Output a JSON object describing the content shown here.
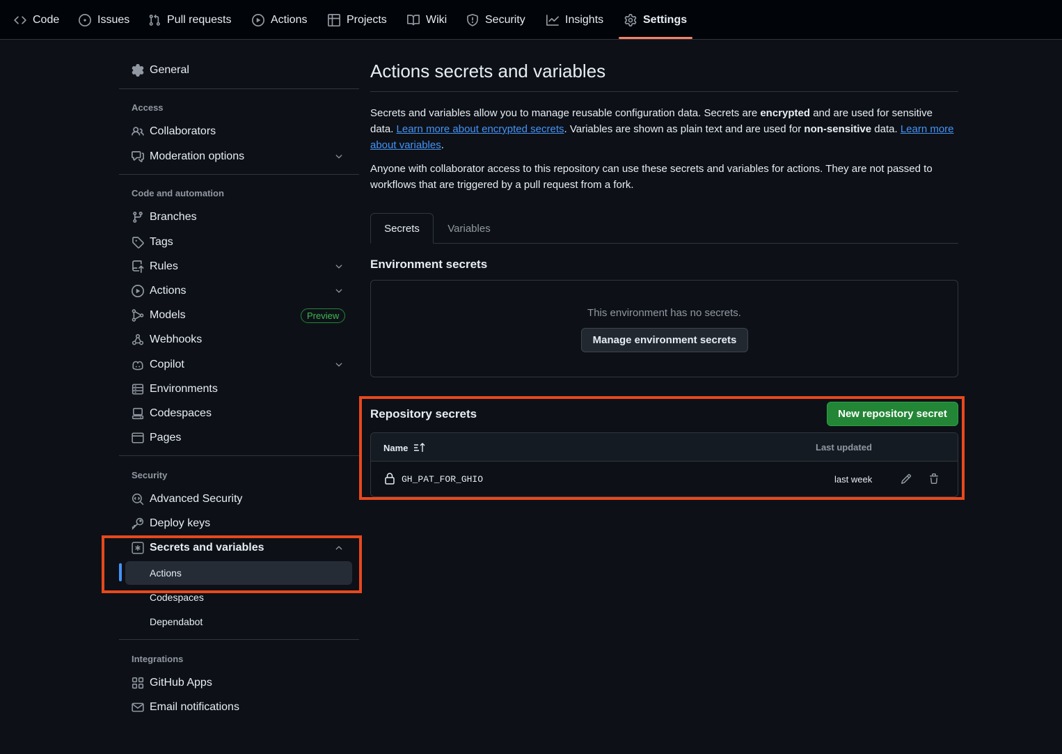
{
  "repo_nav": {
    "tabs": [
      {
        "label": "Code",
        "icon": "code-icon"
      },
      {
        "label": "Issues",
        "icon": "issue-opened-icon"
      },
      {
        "label": "Pull requests",
        "icon": "git-pull-request-icon"
      },
      {
        "label": "Actions",
        "icon": "play-icon"
      },
      {
        "label": "Projects",
        "icon": "table-icon"
      },
      {
        "label": "Wiki",
        "icon": "book-icon"
      },
      {
        "label": "Security",
        "icon": "shield-icon"
      },
      {
        "label": "Insights",
        "icon": "graph-icon"
      },
      {
        "label": "Settings",
        "icon": "gear-icon"
      }
    ],
    "selected": "Settings"
  },
  "sidebar": {
    "general": "General",
    "access": {
      "heading": "Access",
      "items": [
        "Collaborators",
        "Moderation options"
      ]
    },
    "code_automation": {
      "heading": "Code and automation",
      "items": [
        "Branches",
        "Tags",
        "Rules",
        "Actions",
        "Models",
        "Webhooks",
        "Copilot",
        "Environments",
        "Codespaces",
        "Pages"
      ],
      "models_badge": "Preview"
    },
    "security": {
      "heading": "Security",
      "items": [
        "Advanced Security",
        "Deploy keys",
        "Secrets and variables"
      ],
      "sub_items": [
        "Actions",
        "Codespaces",
        "Dependabot"
      ],
      "active_sub_item": "Actions"
    },
    "integrations": {
      "heading": "Integrations",
      "items": [
        "GitHub Apps",
        "Email notifications"
      ]
    }
  },
  "main": {
    "title": "Actions secrets and variables",
    "intro": {
      "p1_a": "Secrets and variables allow you to manage reusable configuration data. Secrets are ",
      "p1_b": "encrypted",
      "p1_c": " and are used for sensitive data. ",
      "p1_link1": "Learn more about encrypted secrets",
      "p1_d": ". Variables are shown as plain text and are used for ",
      "p1_e": "non-sensitive",
      "p1_f": " data. ",
      "p1_link2": "Learn more about variables",
      "p1_g": ".",
      "p2": "Anyone with collaborator access to this repository can use these secrets and variables for actions. They are not passed to workflows that are triggered by a pull request from a fork."
    },
    "tabs": {
      "secrets": "Secrets",
      "variables": "Variables",
      "selected": "Secrets"
    },
    "environment_secrets": {
      "title": "Environment secrets",
      "empty_text": "This environment has no secrets.",
      "manage_button": "Manage environment secrets"
    },
    "repository_secrets": {
      "title": "Repository secrets",
      "new_button": "New repository secret",
      "columns": {
        "name": "Name",
        "updated": "Last updated"
      },
      "rows": [
        {
          "name": "GH_PAT_FOR_GHIO",
          "updated": "last week"
        }
      ]
    }
  },
  "colors": {
    "accent_underline": "#f78166",
    "link": "#4493f8",
    "primary_button": "#238636",
    "annotation": "#e8481e"
  }
}
